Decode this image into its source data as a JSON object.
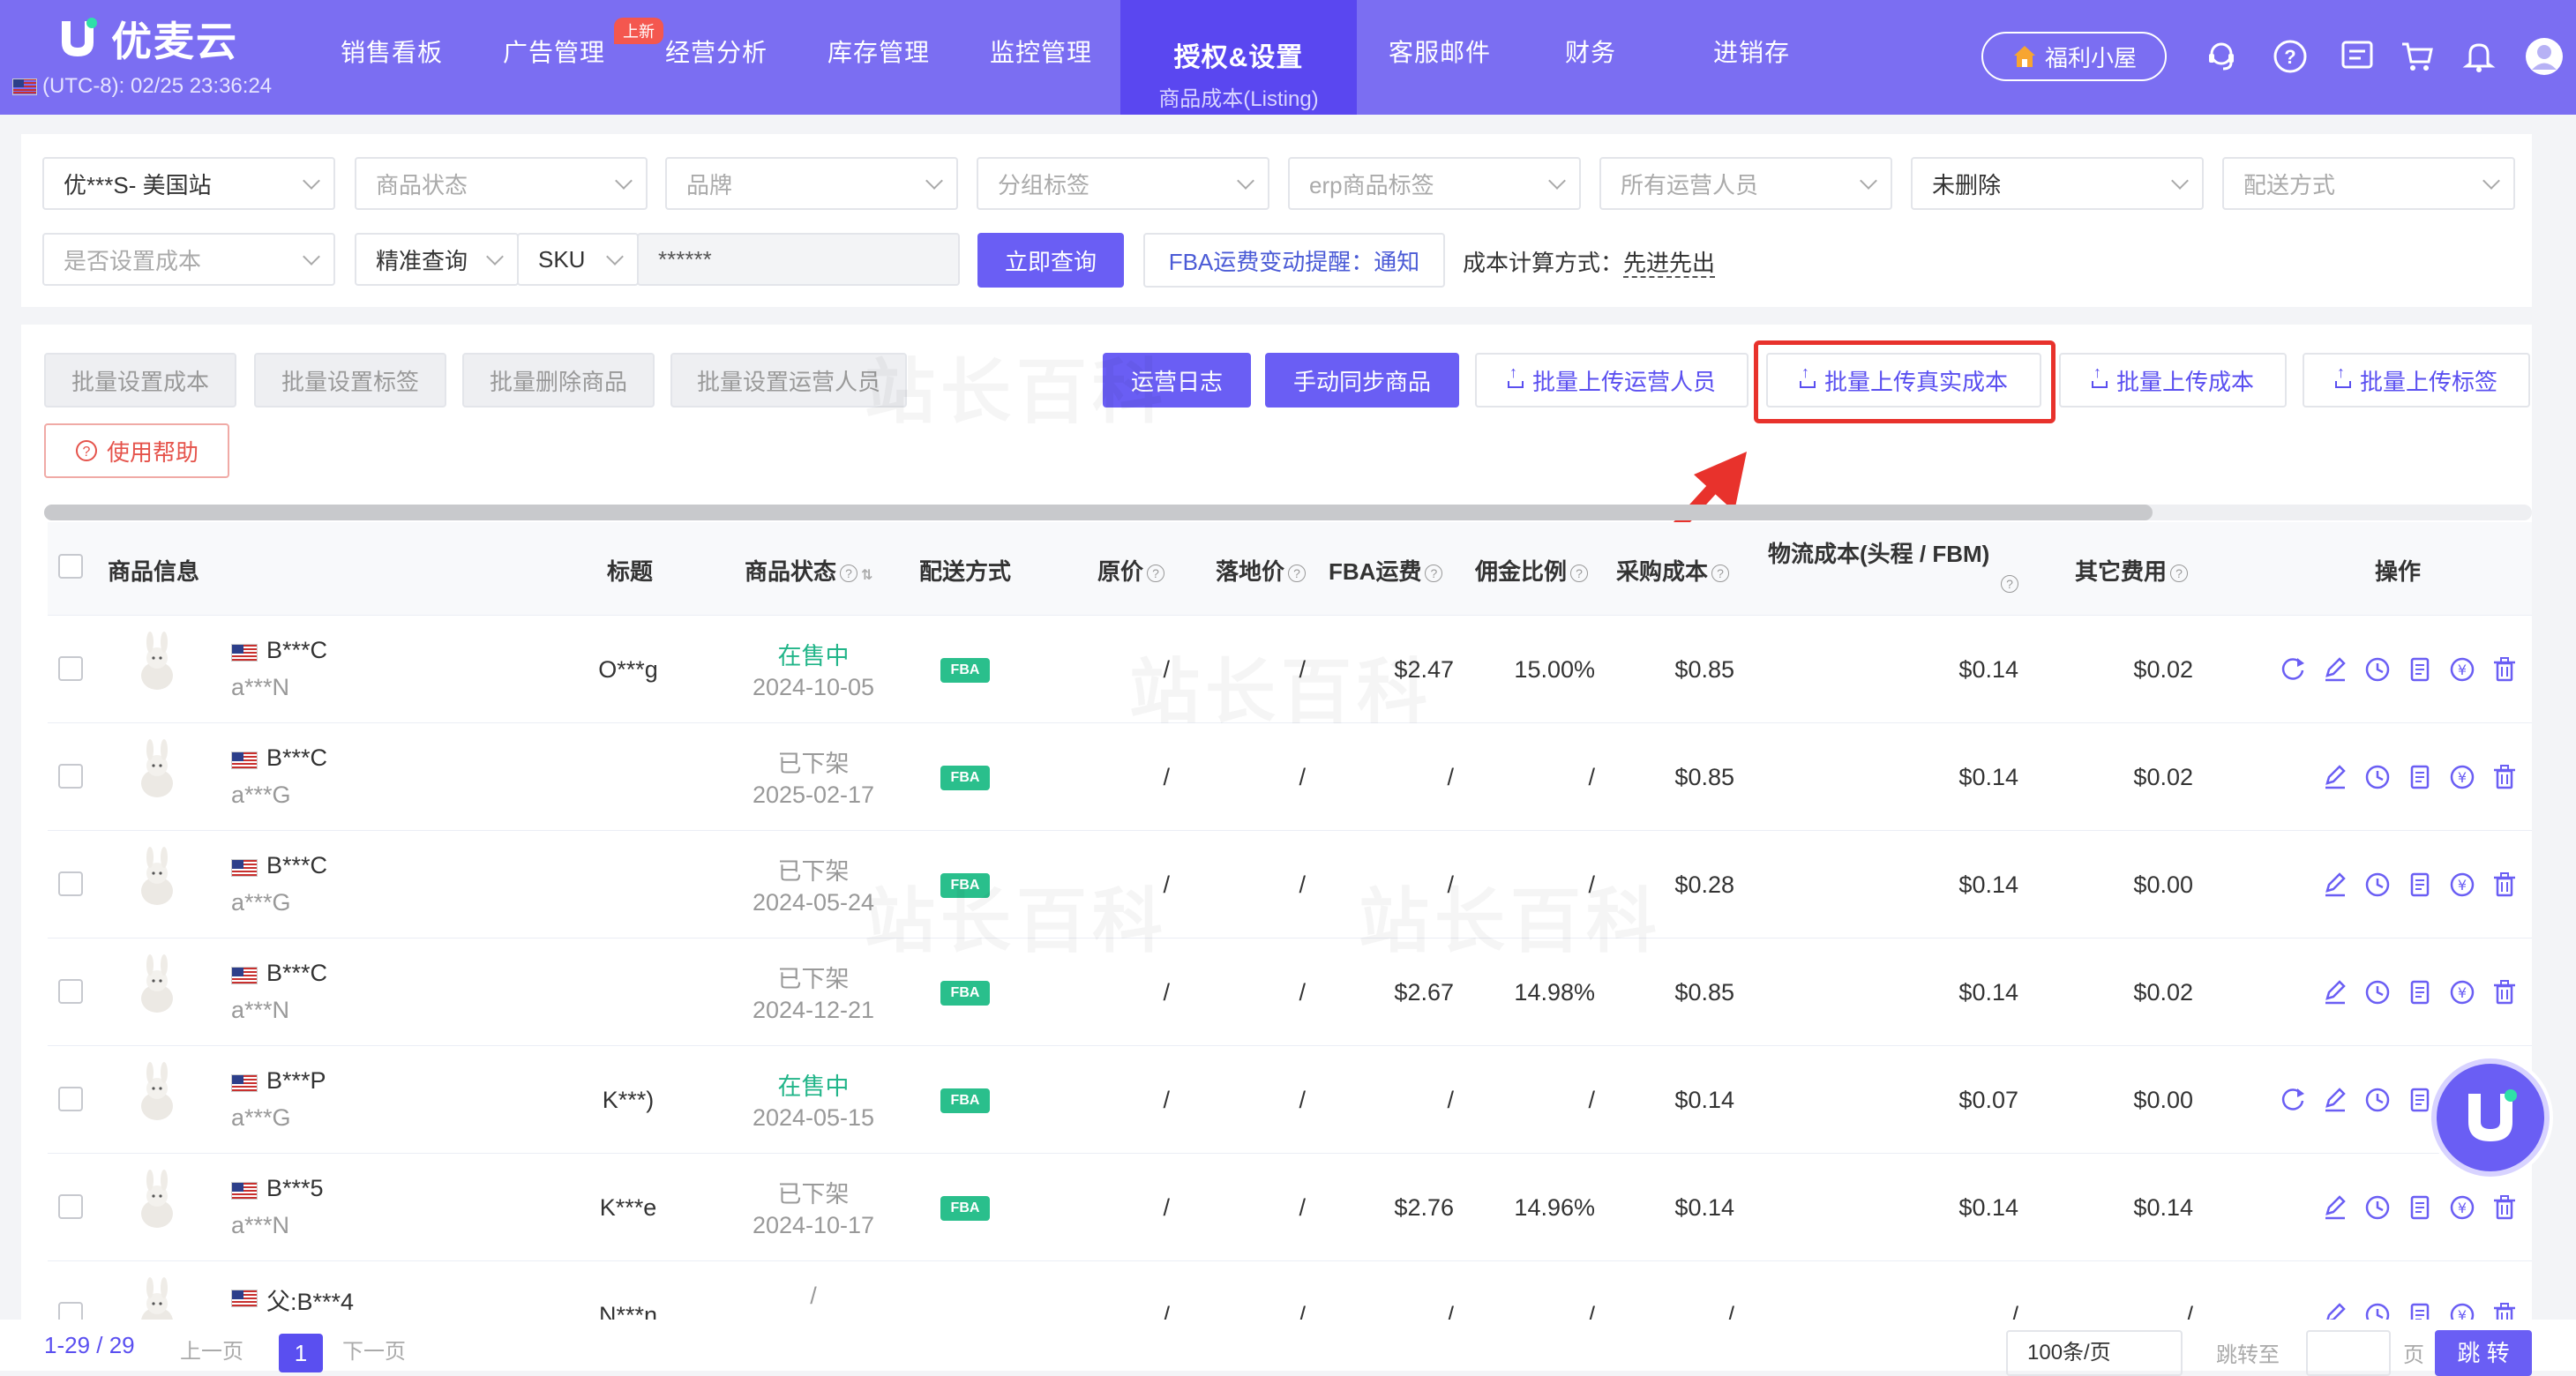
{
  "app": {
    "name": "优麦云",
    "clock": "(UTC-8): 02/25 23:36:24",
    "fuli": "福利小屋"
  },
  "nav": {
    "items": [
      "销售看板",
      "广告管理",
      "经营分析",
      "库存管理",
      "监控管理",
      "授权&设置",
      "客服邮件",
      "财务",
      "进销存"
    ],
    "badge_new": "上新",
    "active_sub": "商品成本(Listing)"
  },
  "filters": {
    "store": "优***S- 美国站",
    "status": "商品状态",
    "brand": "品牌",
    "group_tag": "分组标签",
    "erp_tag": "erp商品标签",
    "operators": "所有运营人员",
    "deleted": "未删除",
    "shipping": "配送方式",
    "cost_set": "是否设置成本",
    "query_mode": "精准查询",
    "field": "SKU",
    "search_value": "******",
    "search_btn": "立即查询",
    "fba_notice": "FBA运费变动提醒：通知",
    "cost_method_label": "成本计算方式：",
    "cost_method_value": "先进先出"
  },
  "toolbar": {
    "batch_set_cost": "批量设置成本",
    "batch_set_tag": "批量设置标签",
    "batch_delete": "批量删除商品",
    "batch_set_operator": "批量设置运营人员",
    "ops_log": "运营日志",
    "manual_sync": "手动同步商品",
    "upload_operator": "批量上传运营人员",
    "upload_real_cost": "批量上传真实成本",
    "upload_cost": "批量上传成本",
    "upload_tag": "批量上传标签",
    "help": "使用帮助"
  },
  "table": {
    "headers": {
      "product": "商品信息",
      "title": "标题",
      "status": "商品状态",
      "shipping": "配送方式",
      "price": "原价",
      "landed": "落地价",
      "fba": "FBA运费",
      "commission": "佣金比例",
      "purchase": "采购成本",
      "logistics": "物流成本(头程 / FBM)",
      "other": "其它费用",
      "ops": "操作"
    },
    "rows": [
      {
        "asin": "B***C",
        "sku": "a***N",
        "title": "O***g",
        "status": "在售中",
        "date": "2024-10-05",
        "ship": "FBA",
        "price": "/",
        "landed": "/",
        "fba": "$2.47",
        "commission": "15.00%",
        "purchase": "$0.85",
        "logistics": "$0.14",
        "other": "$0.02",
        "on_sale": true
      },
      {
        "asin": "B***C",
        "sku": "a***G",
        "title": "",
        "status": "已下架",
        "date": "2025-02-17",
        "ship": "FBA",
        "price": "/",
        "landed": "/",
        "fba": "/",
        "commission": "/",
        "purchase": "$0.85",
        "logistics": "$0.14",
        "other": "$0.02",
        "on_sale": false
      },
      {
        "asin": "B***C",
        "sku": "a***G",
        "title": "",
        "status": "已下架",
        "date": "2024-05-24",
        "ship": "FBA",
        "price": "/",
        "landed": "/",
        "fba": "/",
        "commission": "/",
        "purchase": "$0.28",
        "logistics": "$0.14",
        "other": "$0.00",
        "on_sale": false
      },
      {
        "asin": "B***C",
        "sku": "a***N",
        "title": "",
        "status": "已下架",
        "date": "2024-12-21",
        "ship": "FBA",
        "price": "/",
        "landed": "/",
        "fba": "$2.67",
        "commission": "14.98%",
        "purchase": "$0.85",
        "logistics": "$0.14",
        "other": "$0.02",
        "on_sale": false
      },
      {
        "asin": "B***P",
        "sku": "a***G",
        "title": "K***)",
        "status": "在售中",
        "date": "2024-05-15",
        "ship": "FBA",
        "price": "/",
        "landed": "/",
        "fba": "/",
        "commission": "/",
        "purchase": "$0.14",
        "logistics": "$0.07",
        "other": "$0.00",
        "on_sale": true
      },
      {
        "asin": "B***5",
        "sku": "a***N",
        "title": "K***e",
        "status": "已下架",
        "date": "2024-10-17",
        "ship": "FBA",
        "price": "/",
        "landed": "/",
        "fba": "$2.76",
        "commission": "14.96%",
        "purchase": "$0.14",
        "logistics": "$0.14",
        "other": "$0.14",
        "on_sale": false
      },
      {
        "asin": "父:B***4",
        "sku": "",
        "title": "N***n",
        "status": "/",
        "date": "",
        "ship": "",
        "price": "/",
        "landed": "/",
        "fba": "/",
        "commission": "/",
        "purchase": "/",
        "logistics": "/",
        "other": "/",
        "on_sale": false
      }
    ]
  },
  "pagination": {
    "range": "1-29 / 29",
    "prev": "上一页",
    "current": "1",
    "next": "下一页",
    "page_size": "100条/页",
    "jump_to": "跳转至",
    "page_unit": "页",
    "go": "跳 转"
  },
  "watermark": "站长百科",
  "colors": {
    "nav_bg": "#7b6ef2",
    "primary": "#6a5ef4",
    "highlight": "#e8322c",
    "on_sale": "#22b589",
    "fba_badge": "#2abf8c"
  }
}
